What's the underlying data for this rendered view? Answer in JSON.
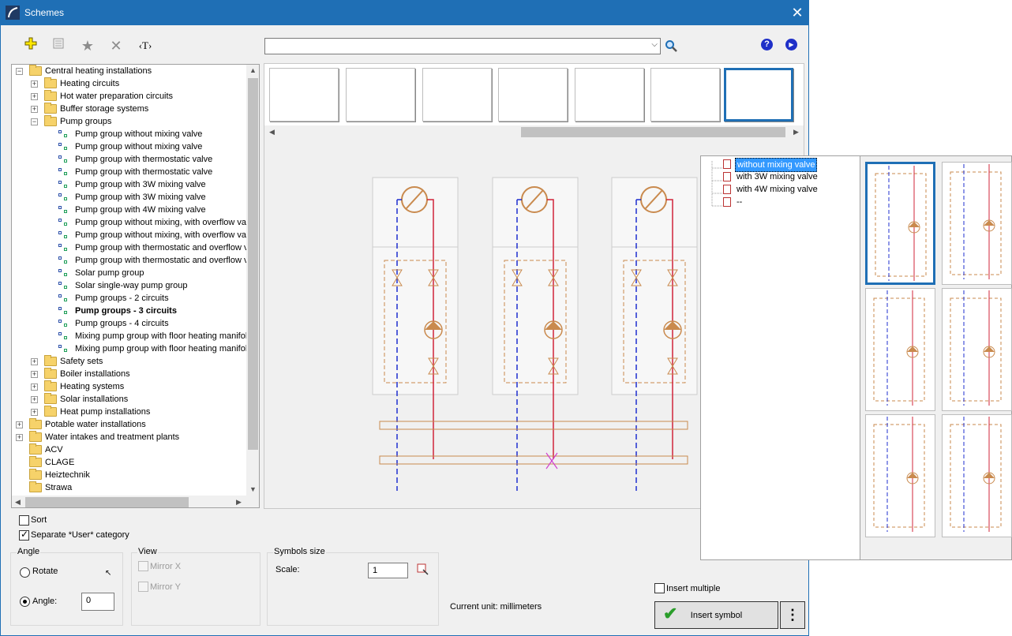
{
  "window": {
    "title": "Schemes",
    "close_symbol": "✕"
  },
  "toolbar": {
    "add_icon": "add-icon",
    "properties_icon": "properties-icon",
    "favorite_icon": "star-icon",
    "delete_icon": "delete-icon",
    "text_label": "‹T›"
  },
  "search": {
    "value": "",
    "arrow": "⌵"
  },
  "help": {
    "help_symbol": "?",
    "next_symbol": "▶"
  },
  "tree": [
    {
      "level": 0,
      "kind": "folder",
      "expander": "−",
      "label": "Central heating installations"
    },
    {
      "level": 1,
      "kind": "folder",
      "expander": "+",
      "label": "Heating circuits"
    },
    {
      "level": 1,
      "kind": "folder",
      "expander": "+",
      "label": "Hot water preparation circuits"
    },
    {
      "level": 1,
      "kind": "folder",
      "expander": "+",
      "label": "Buffer storage systems"
    },
    {
      "level": 1,
      "kind": "folder",
      "expander": "−",
      "label": "Pump groups"
    },
    {
      "level": 2,
      "kind": "leaf",
      "label": "Pump group without mixing valve"
    },
    {
      "level": 2,
      "kind": "leaf",
      "label": "Pump group without mixing valve"
    },
    {
      "level": 2,
      "kind": "leaf",
      "label": "Pump group with thermostatic valve"
    },
    {
      "level": 2,
      "kind": "leaf",
      "label": "Pump group with thermostatic valve"
    },
    {
      "level": 2,
      "kind": "leaf",
      "label": "Pump group with 3W mixing valve"
    },
    {
      "level": 2,
      "kind": "leaf",
      "label": "Pump group with 3W mixing valve"
    },
    {
      "level": 2,
      "kind": "leaf",
      "label": "Pump group with 4W mixing valve"
    },
    {
      "level": 2,
      "kind": "leaf",
      "label": "Pump group without mixing, with overflow va"
    },
    {
      "level": 2,
      "kind": "leaf",
      "label": "Pump group without mixing, with overflow va"
    },
    {
      "level": 2,
      "kind": "leaf",
      "label": "Pump group with thermostatic and overflow v"
    },
    {
      "level": 2,
      "kind": "leaf",
      "label": "Pump group with thermostatic and overflow v"
    },
    {
      "level": 2,
      "kind": "leaf",
      "label": "Solar pump group"
    },
    {
      "level": 2,
      "kind": "leaf",
      "label": "Solar single-way pump group"
    },
    {
      "level": 2,
      "kind": "leaf",
      "label": "Pump groups - 2 circuits"
    },
    {
      "level": 2,
      "kind": "leaf",
      "label": "Pump groups - 3 circuits",
      "selected": true
    },
    {
      "level": 2,
      "kind": "leaf",
      "label": "Pump groups - 4 circuits"
    },
    {
      "level": 2,
      "kind": "leaf",
      "label": "Mixing pump group with floor heating manifol"
    },
    {
      "level": 2,
      "kind": "leaf",
      "label": "Mixing pump group with floor heating manifol"
    },
    {
      "level": 1,
      "kind": "folder",
      "expander": "+",
      "label": "Safety sets"
    },
    {
      "level": 1,
      "kind": "folder",
      "expander": "+",
      "label": "Boiler installations"
    },
    {
      "level": 1,
      "kind": "folder",
      "expander": "+",
      "label": "Heating systems"
    },
    {
      "level": 1,
      "kind": "folder",
      "expander": "+",
      "label": "Solar installations"
    },
    {
      "level": 1,
      "kind": "folder",
      "expander": "+",
      "label": "Heat pump installations"
    },
    {
      "level": 0,
      "kind": "folder",
      "expander": "+",
      "label": "Potable water installations"
    },
    {
      "level": 0,
      "kind": "folder",
      "expander": "+",
      "label": "Water intakes and treatment plants"
    },
    {
      "level": 0,
      "kind": "folder",
      "label": "ACV"
    },
    {
      "level": 0,
      "kind": "folder",
      "label": "CLAGE"
    },
    {
      "level": 0,
      "kind": "folder",
      "label": "Heiztechnik"
    },
    {
      "level": 0,
      "kind": "folder",
      "label": "Strawa"
    }
  ],
  "options": {
    "sort_label": "Sort",
    "sort_checked": false,
    "separate_label": "Separate *User* category",
    "separate_checked": true
  },
  "angle": {
    "title": "Angle",
    "rotate_label": "Rotate",
    "angle_label": "Angle:",
    "angle_value": "0",
    "rotate_selected": false
  },
  "view": {
    "title": "View",
    "mirror_x": "Mirror X",
    "mirror_y": "Mirror Y"
  },
  "symbols": {
    "title": "Symbols size",
    "scale_label": "Scale:",
    "scale_value": "1"
  },
  "status": {
    "current_unit": "Current unit: millimeters"
  },
  "insert": {
    "multiple_label": "Insert multiple",
    "button_label": "Insert symbol",
    "more_label": "⋮"
  },
  "variants": [
    {
      "label": "without mixing valve",
      "selected": true
    },
    {
      "label": "with 3W mixing valve"
    },
    {
      "label": "with 4W mixing valve"
    },
    {
      "label": "--"
    }
  ],
  "colors": {
    "accent": "#1f6fb5",
    "pipe_supply": "#d0243a",
    "pipe_return": "#1f2fcf",
    "fitting": "#c98a4e"
  }
}
